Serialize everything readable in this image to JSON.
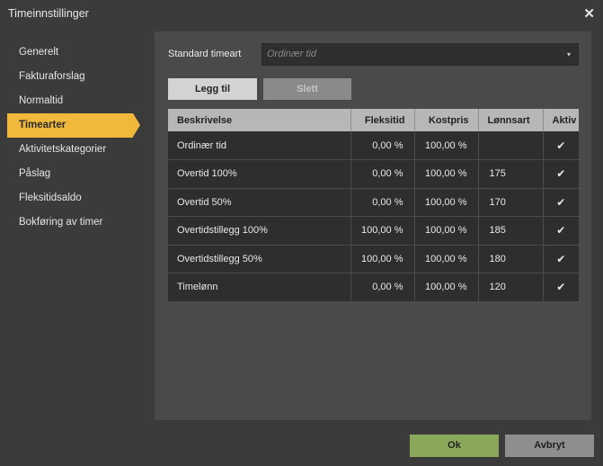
{
  "window": {
    "title": "Timeinnstillinger",
    "close_glyph": "✕"
  },
  "sidebar": {
    "items": [
      {
        "label": "Generelt",
        "active": false
      },
      {
        "label": "Fakturaforslag",
        "active": false
      },
      {
        "label": "Normaltid",
        "active": false
      },
      {
        "label": "Timearter",
        "active": true
      },
      {
        "label": "Aktivitetskategorier",
        "active": false
      },
      {
        "label": "Påslag",
        "active": false
      },
      {
        "label": "Fleksitidsaldo",
        "active": false
      },
      {
        "label": "Bokføring av timer",
        "active": false
      }
    ]
  },
  "main": {
    "standard_label": "Standard timeart",
    "standard_placeholder": "Ordinær tid",
    "dropdown_caret": "▾",
    "add_label": "Legg til",
    "delete_label": "Slett",
    "columns": [
      "Beskrivelse",
      "Fleksitid",
      "Kostpris",
      "Lønnsart",
      "Aktiv"
    ],
    "rows": [
      {
        "desc": "Ordinær tid",
        "flex": "0,00 %",
        "cost": "100,00 %",
        "lonn": "",
        "active": "✔"
      },
      {
        "desc": "Overtid 100%",
        "flex": "0,00 %",
        "cost": "100,00 %",
        "lonn": "175",
        "active": "✔"
      },
      {
        "desc": "Overtid 50%",
        "flex": "0,00 %",
        "cost": "100,00 %",
        "lonn": "170",
        "active": "✔"
      },
      {
        "desc": "Overtidstillegg 100%",
        "flex": "100,00 %",
        "cost": "100,00 %",
        "lonn": "185",
        "active": "✔"
      },
      {
        "desc": "Overtidstillegg 50%",
        "flex": "100,00 %",
        "cost": "100,00 %",
        "lonn": "180",
        "active": "✔"
      },
      {
        "desc": "Timelønn",
        "flex": "0,00 %",
        "cost": "100,00 %",
        "lonn": "120",
        "active": "✔"
      }
    ]
  },
  "footer": {
    "ok_label": "Ok",
    "cancel_label": "Avbryt"
  },
  "colors": {
    "accent": "#f0b93c",
    "ok": "#8aa85a",
    "background": "#3b3b3b",
    "panel": "#4a4a4a"
  }
}
